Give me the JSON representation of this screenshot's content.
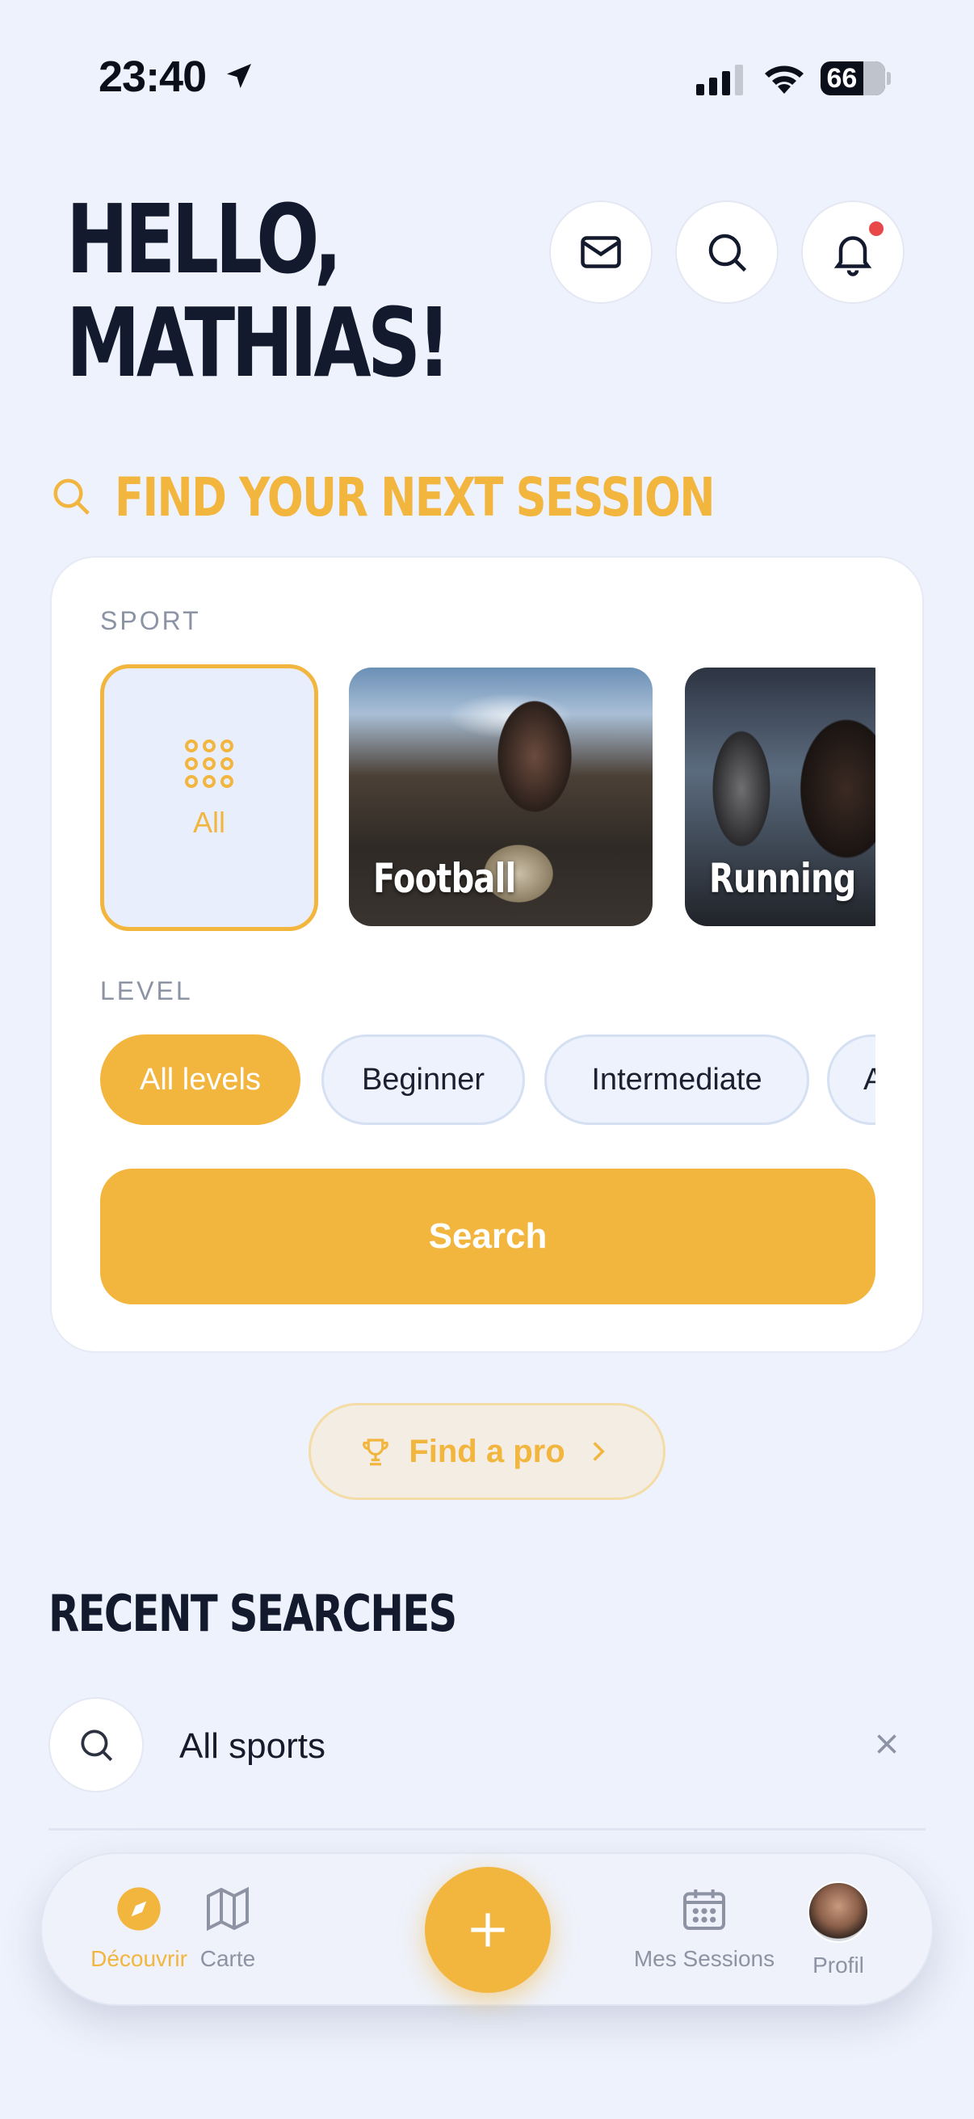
{
  "status_bar": {
    "time": "23:40",
    "battery": "66",
    "battery_level": 0.66
  },
  "header": {
    "greeting_line1": "HELLO,",
    "greeting_line2": "MATHIAS!",
    "icons": [
      "mail-icon",
      "search-icon",
      "bell-icon"
    ],
    "has_notification": true
  },
  "finder": {
    "title": "FIND YOUR NEXT SESSION",
    "sport_label": "SPORT",
    "sports": [
      {
        "label": "All",
        "icon": "grid-icon",
        "selected": true
      },
      {
        "label": "Football",
        "selected": false
      },
      {
        "label": "Running",
        "selected": false
      }
    ],
    "level_label": "LEVEL",
    "levels": [
      {
        "label": "All levels",
        "selected": true
      },
      {
        "label": "Beginner",
        "selected": false
      },
      {
        "label": "Intermediate",
        "selected": false
      },
      {
        "label": "A",
        "selected": false
      }
    ],
    "search_button": "Search"
  },
  "find_pro": {
    "label": "Find a pro",
    "icon": "trophy-icon"
  },
  "recent": {
    "title": "RECENT SEARCHES",
    "items": [
      {
        "label": "All sports"
      }
    ]
  },
  "tabbar": {
    "tabs": [
      {
        "label": "Découvrir",
        "icon": "compass-icon",
        "active": true
      },
      {
        "label": "Carte",
        "icon": "map-icon",
        "active": false
      },
      {
        "label": "Mes Sessions",
        "icon": "calendar-icon",
        "active": false
      },
      {
        "label": "Profil",
        "icon": "avatar",
        "active": false
      }
    ],
    "fab_icon": "plus-icon"
  },
  "colors": {
    "accent": "#f2b53e",
    "background": "#eef2fc",
    "ink": "#131a2e",
    "muted": "#8b93a5",
    "notification": "#e8484a"
  }
}
